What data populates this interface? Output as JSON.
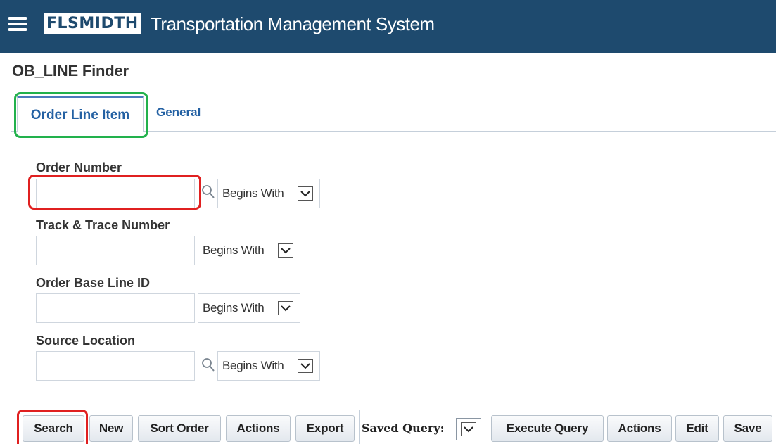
{
  "header": {
    "logo_text": "FLSMIDTH",
    "app_title": "Transportation Management System",
    "bg_color": "#1e4a6e"
  },
  "page": {
    "title": "OB_LINE Finder"
  },
  "tabs": [
    {
      "label": "Order Line Item",
      "active": true
    },
    {
      "label": "General",
      "active": false
    }
  ],
  "fields": [
    {
      "label": "Order Number",
      "value": "",
      "has_lookup": true,
      "operator": "Begins With",
      "focused": true
    },
    {
      "label": "Track & Trace Number",
      "value": "",
      "has_lookup": false,
      "operator": "Begins With",
      "focused": false
    },
    {
      "label": "Order Base Line ID",
      "value": "",
      "has_lookup": false,
      "operator": "Begins With",
      "focused": false
    },
    {
      "label": "Source Location",
      "value": "",
      "has_lookup": true,
      "operator": "Begins With",
      "focused": false
    }
  ],
  "toolbar": {
    "search_label": "Search",
    "new_label": "New",
    "sort_order_label": "Sort Order",
    "actions_label": "Actions",
    "export_label": "Export",
    "saved_query_label": "Saved Query:",
    "execute_query_label": "Execute Query",
    "query_actions_label": "Actions",
    "edit_label": "Edit",
    "save_label": "Save"
  },
  "highlight_colors": {
    "green": "#22b14c",
    "red": "#e02020"
  }
}
